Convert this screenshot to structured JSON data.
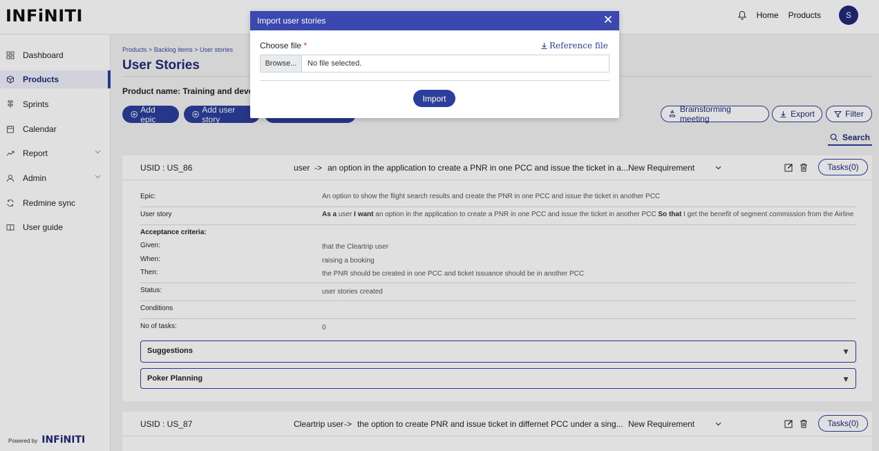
{
  "header": {
    "logo": "INFiNITI",
    "nav": {
      "home": "Home",
      "products": "Products"
    },
    "avatar_initial": "S"
  },
  "sidebar": {
    "items": [
      {
        "label": "Dashboard",
        "icon": "grid-icon"
      },
      {
        "label": "Products",
        "icon": "cube-icon"
      },
      {
        "label": "Sprints",
        "icon": "sprint-icon"
      },
      {
        "label": "Calendar",
        "icon": "calendar-icon"
      },
      {
        "label": "Report",
        "icon": "trend-icon"
      },
      {
        "label": "Admin",
        "icon": "user-icon"
      },
      {
        "label": "Redmine sync",
        "icon": "sync-icon"
      },
      {
        "label": "User guide",
        "icon": "book-icon"
      }
    ],
    "powered_by": "Powered by",
    "powered_logo": "INFiNITI"
  },
  "main": {
    "breadcrumb": "Products > Backlog items > User stories",
    "title": "User Stories",
    "product_name": "Product name: Training and developm",
    "buttons": {
      "add_epic": "Add epic",
      "add_user_story": "Add user story",
      "brainstorming": "Brainstorming meeting",
      "export": "Export",
      "filter": "Filter",
      "search": "Search"
    }
  },
  "stories": [
    {
      "usid": "USID : US_86",
      "role": "user",
      "arrow": "->",
      "want": "an option in the application to create a PNR in one PCC and issue the ticket in a...",
      "status": "New Requirement",
      "tasks": "Tasks(0)",
      "details": {
        "epic_label": "Epic:",
        "epic": "An option to show the flight search results and create the PNR in one PCC and issue the ticket in another PCC",
        "story_label": "User story",
        "story_as": "As a",
        "story_role": " user ",
        "story_want_kw": "I want",
        "story_want": " an option in the application to create a PNR in one PCC and issue the ticket in another PCC ",
        "story_so_kw": "So that",
        "story_so": " I get the benefit of segment commission from the Airline",
        "acceptance_label": "Acceptance criteria:",
        "given_label": "Given:",
        "given": "that the Cleartrip user",
        "when_label": "When:",
        "when": "raising a booking",
        "then_label": "Then:",
        "then": "the PNR should be created in one PCC and ticket issuance should be in another PCC",
        "status_label": "Status:",
        "status": "user stories created",
        "conditions_label": "Conditions",
        "tasks_label": "No of tasks:",
        "tasks": "0",
        "suggestions": "Suggestions",
        "poker": "Poker Planning",
        "accordion_arrow": "▼"
      }
    },
    {
      "usid": "USID : US_87",
      "role": "Cleartrip user",
      "arrow": "->",
      "want": "the option to create PNR and issue ticket in differnet PCC under a sing...",
      "status": "New Requirement",
      "tasks": "Tasks(0)"
    }
  ],
  "modal": {
    "title": "Import user stories",
    "choose_label": "Choose file",
    "required_mark": "*",
    "reference_link": "Reference file",
    "browse": "Browse...",
    "no_file": "No file selected.",
    "import": "Import"
  },
  "colors": {
    "primary": "#2c3e9c",
    "modal_header": "#3a48b0",
    "avatar": "#1f2a7a"
  }
}
